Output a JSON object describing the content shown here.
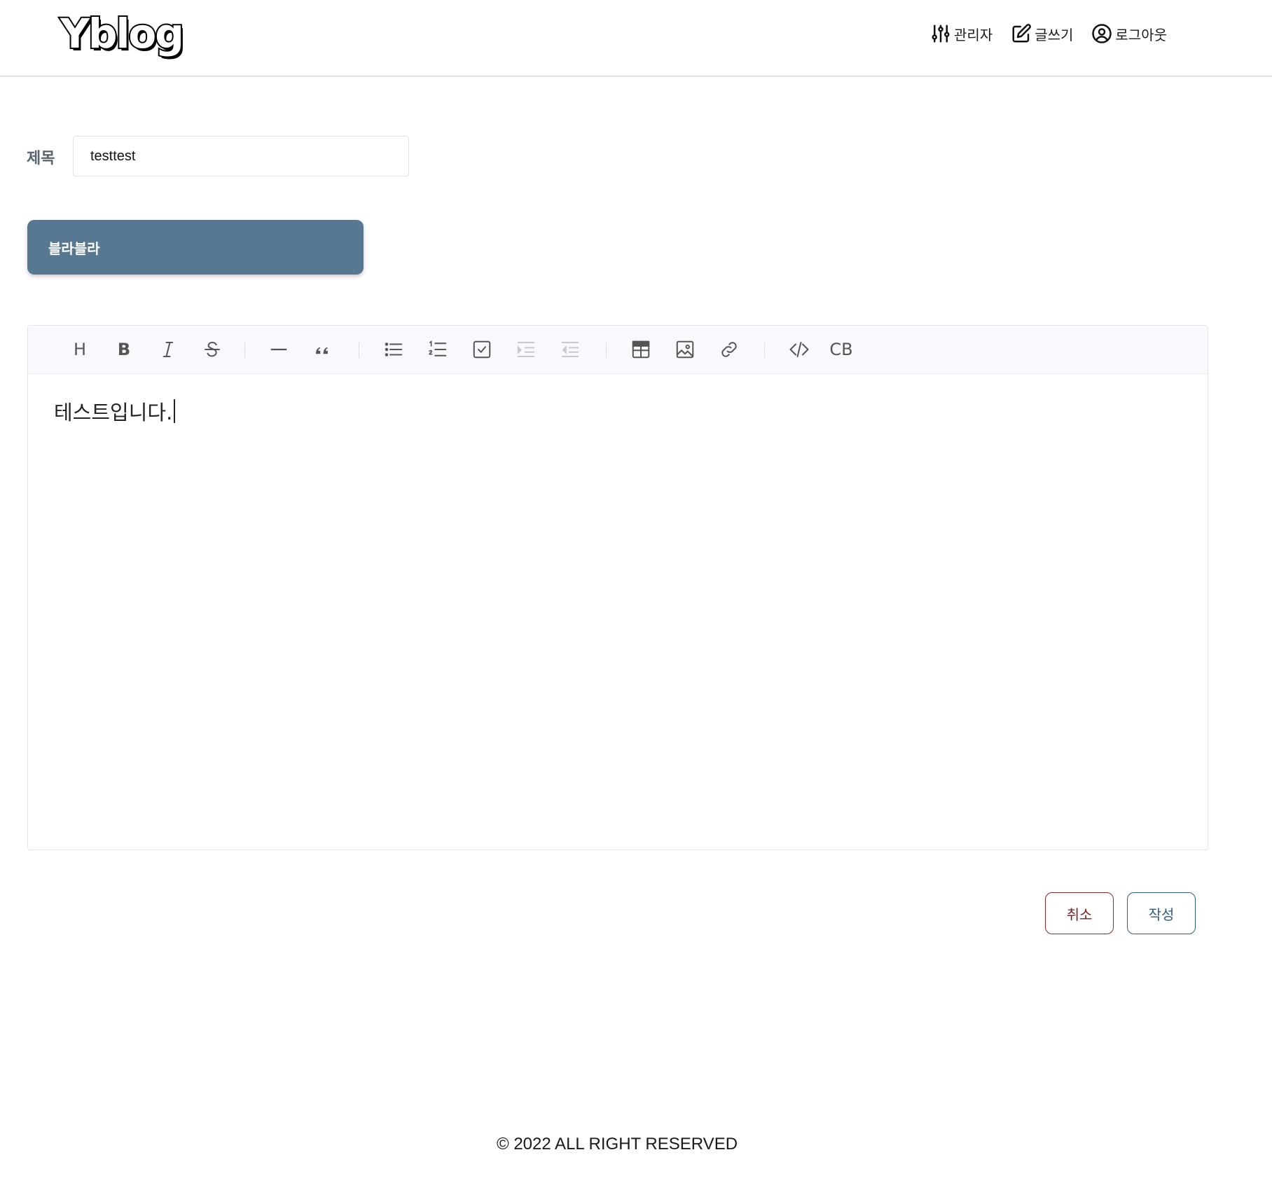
{
  "header": {
    "logo": "Yblog",
    "nav": [
      {
        "label": "관리자",
        "icon": "sliders-icon"
      },
      {
        "label": "글쓰기",
        "icon": "edit-icon"
      },
      {
        "label": "로그아웃",
        "icon": "user-circle-icon"
      }
    ]
  },
  "form": {
    "title_label": "제목",
    "title_value": "testtest",
    "category_selected": "블라블라"
  },
  "editor": {
    "toolbar": {
      "heading": "H",
      "bold": "B",
      "codeblock": "CB"
    },
    "content": "테스트입니다."
  },
  "actions": {
    "cancel": "취소",
    "submit": "작성"
  },
  "footer": {
    "text": "© 2022 ALL RIGHT RESERVED"
  },
  "colors": {
    "category_bg": "#587891",
    "cancel_color": "#7a1e1e",
    "submit_color": "#2f5c82"
  }
}
